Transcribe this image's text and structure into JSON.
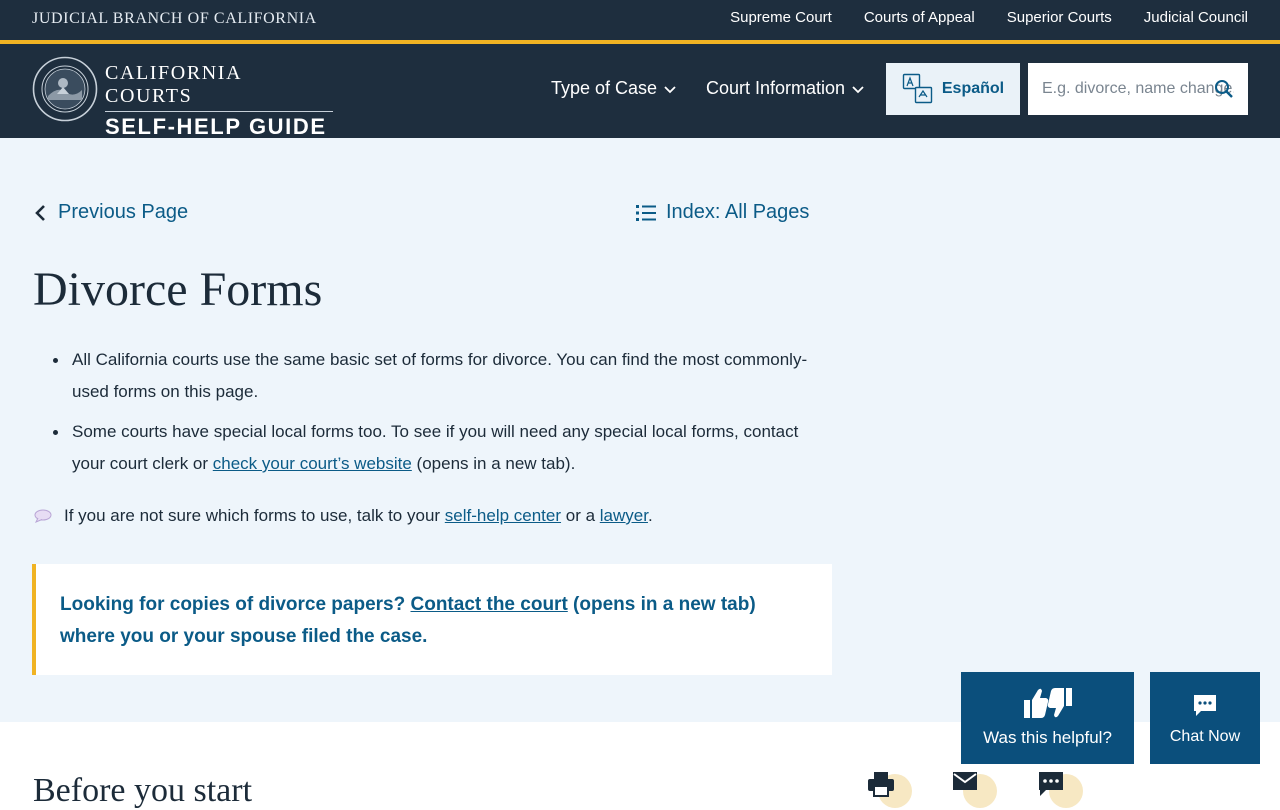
{
  "colors": {
    "navy": "#1e2e3e",
    "gold": "#f0b323",
    "link": "#0b5b87",
    "widget": "#0b4f7c",
    "page_bg": "#eef5fb"
  },
  "topbar": {
    "branch": "JUDICIAL BRANCH OF CALIFORNIA",
    "links": [
      "Supreme Court",
      "Courts of Appeal",
      "Superior Courts",
      "Judicial Council"
    ]
  },
  "header": {
    "seal_icon": "california-judicial-council-seal",
    "brand_line1": "CALIFORNIA COURTS",
    "brand_line2": "SELF-HELP GUIDE",
    "nav": [
      {
        "label": "Type of Case",
        "icon": "chevron-down-icon"
      },
      {
        "label": "Court Information",
        "icon": "chevron-down-icon"
      }
    ],
    "language_button": {
      "label": "Español",
      "icon": "translate-icon"
    },
    "search": {
      "placeholder": "E.g. divorce, name change, ...",
      "icon": "search-icon"
    }
  },
  "page": {
    "prev_link": "Previous Page",
    "index_link": "Index: All Pages",
    "title": "Divorce Forms",
    "bullets": [
      {
        "text": "All California courts use the same basic set of forms for divorce. You can find the most commonly-used forms on this page."
      },
      {
        "before": "Some courts have special local forms too. To see if you will need any special local forms, contact your court clerk or ",
        "link": "check your court’s website",
        "after": " (opens in a new tab)."
      }
    ],
    "tip": {
      "before": "If you are not sure which forms to use, talk to your ",
      "link1": "self-help center",
      "middle": " or a ",
      "link2": "lawyer",
      "after": "."
    },
    "callout": {
      "before": "Looking for copies of divorce papers? ",
      "link": "Contact the court",
      "after": " (opens in a new tab) where you or your spouse filed the case."
    }
  },
  "lower": {
    "section_title": "Before you start",
    "tools": [
      "print-icon",
      "email-icon",
      "text-message-icon"
    ]
  },
  "widgets": {
    "helpful": "Was this helpful?",
    "chat": "Chat Now"
  }
}
